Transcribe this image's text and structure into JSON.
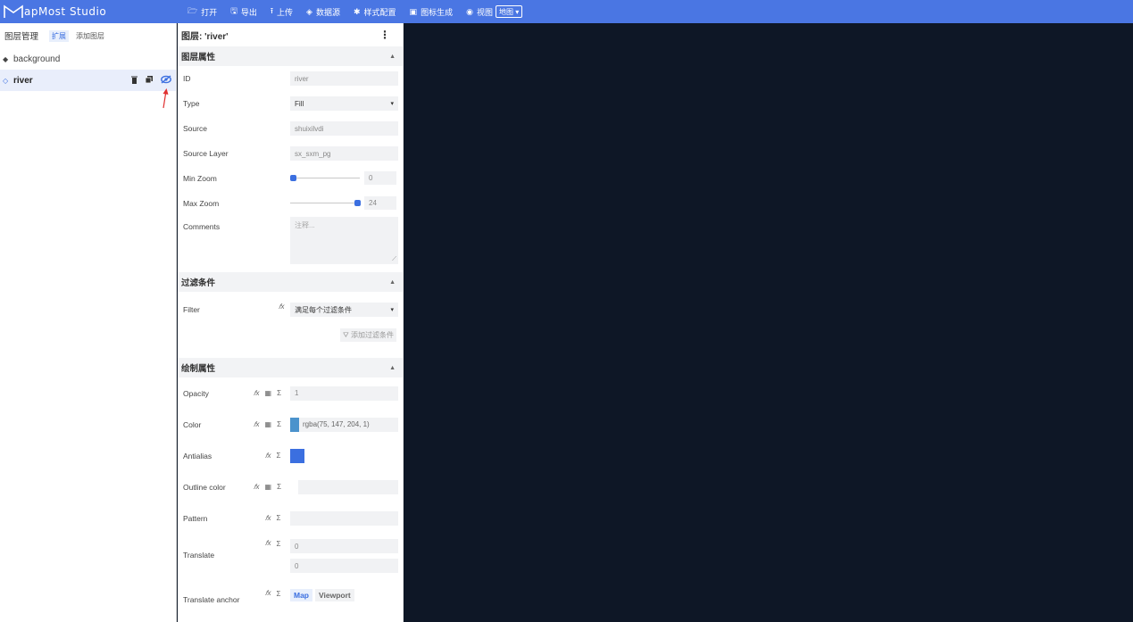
{
  "app": {
    "title": "MapMost Studio",
    "logo_letter": "M",
    "logo_rest": "apMost Studio",
    "accent": "#4a76e3"
  },
  "menu": [
    {
      "icon": "folder-open-icon",
      "glyph": "🗁",
      "label": "打开"
    },
    {
      "icon": "save-icon",
      "glyph": "🖫",
      "label": "导出"
    },
    {
      "icon": "upload-icon",
      "glyph": "⭱",
      "label": "上传"
    },
    {
      "icon": "database-icon",
      "glyph": "◈",
      "label": "数据源"
    },
    {
      "icon": "gear-icon",
      "glyph": "✱",
      "label": "样式配置"
    },
    {
      "icon": "image-icon",
      "glyph": "▣",
      "label": "图标生成"
    },
    {
      "icon": "eye-icon",
      "glyph": "◉",
      "label": "视图"
    }
  ],
  "view_select": {
    "value": "地图",
    "caret": "▾"
  },
  "layers_panel": {
    "title": "图层管理",
    "expand_tag": "扩展",
    "add_link": "添加图层",
    "items": [
      {
        "bullet": "◆",
        "name": "background"
      },
      {
        "bullet": "◇",
        "name": "river"
      }
    ],
    "row_actions": {
      "delete": "🗑",
      "duplicate": "❐",
      "visibility": "👁"
    }
  },
  "props_panel": {
    "title": "图层: 'river'",
    "more": "⋮",
    "sections": {
      "layer_props": "图层属性",
      "filter": "过滤条件",
      "paint": "绘制属性"
    },
    "caret_up": "▲",
    "fields": {
      "id_label": "ID",
      "id_value": "river",
      "type_label": "Type",
      "type_value": "Fill",
      "type_caret": "▾",
      "source_label": "Source",
      "source_value": "shuixilvdi",
      "source_layer_label": "Source Layer",
      "source_layer_value": "sx_sxm_pg",
      "min_zoom_label": "Min Zoom",
      "min_zoom_value": "0",
      "max_zoom_label": "Max Zoom",
      "max_zoom_value": "24",
      "comments_label": "Comments",
      "comments_placeholder": "注释...",
      "filter_label": "Filter",
      "filter_value": "满足每个过滤条件",
      "filter_caret": "▾",
      "add_filter": "添加过滤条件",
      "add_filter_icon": "⛛",
      "opacity_label": "Opacity",
      "opacity_value": "1",
      "color_label": "Color",
      "color_value": "rgba(75, 147, 204, 1)",
      "color_swatch": "#4b93cc",
      "antialias_label": "Antialias",
      "antialias_on_color": "#3b6fe0",
      "outline_label": "Outline color",
      "pattern_label": "Pattern",
      "translate_label": "Translate",
      "translate_x": "0",
      "translate_y": "0",
      "anchor_label": "Translate anchor",
      "anchor_map": "Map",
      "anchor_viewport": "Viewport"
    },
    "fx_glyph": "𝑓x",
    "data_glyph": "▦",
    "sigma_glyph": "Σ"
  },
  "map": {
    "background": "#0e1726"
  }
}
